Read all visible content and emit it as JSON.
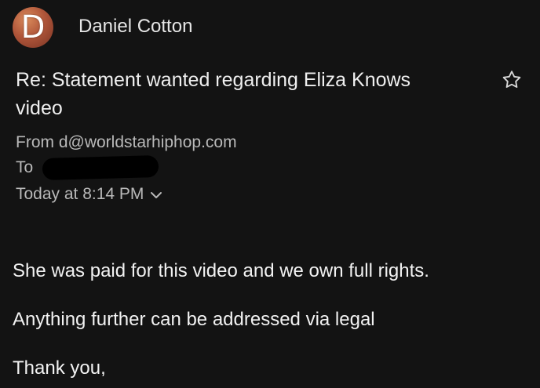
{
  "header": {
    "avatar_letter": "D",
    "sender_name": "Daniel Cotton"
  },
  "subject": "Re: Statement wanted regarding Eliza Knows video",
  "meta": {
    "from_label": "From",
    "from_address": "d@worldstarhiphop.com",
    "to_label": "To",
    "date": "Today at 8:14 PM"
  },
  "body": {
    "lines": [
      "She was paid for this video and we own full rights.",
      "Anything further can be addressed via legal",
      "Thank you,"
    ]
  },
  "icons": {
    "star": "star-outline-icon",
    "details_toggle": "chevron-down-icon"
  },
  "colors": {
    "background": "#131313",
    "avatar": "#b0563a",
    "meta_text": "#b9b9b9"
  }
}
